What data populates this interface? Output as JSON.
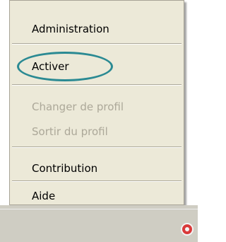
{
  "menu": {
    "items": [
      {
        "label": "Administration",
        "enabled": true
      },
      {
        "label": "Activer",
        "enabled": true,
        "highlighted": true
      },
      {
        "label": "Changer de profil",
        "enabled": false
      },
      {
        "label": "Sortir du profil",
        "enabled": false
      },
      {
        "label": "Contribution",
        "enabled": true
      },
      {
        "label": "Aide",
        "enabled": true
      }
    ]
  },
  "colors": {
    "menu_background": "#ece9d8",
    "disabled_text": "#aca899",
    "highlight_ellipse": "#2b8a93",
    "tray_icon": "#d93a3a"
  },
  "taskbar": {
    "tray_icon": "red-circle-icon"
  }
}
